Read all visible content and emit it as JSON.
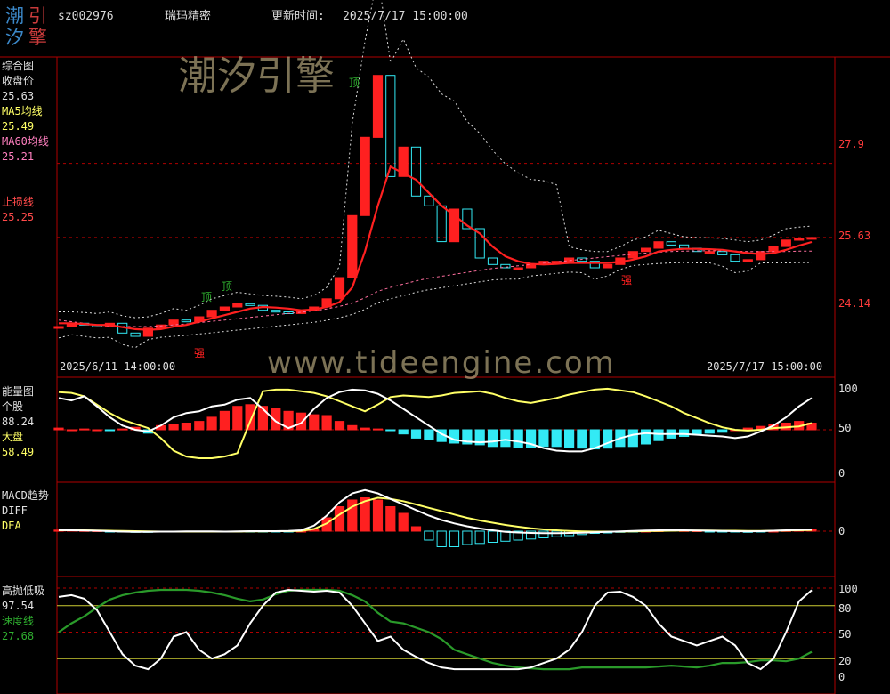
{
  "header": {
    "logo": [
      "潮",
      "引",
      "汐",
      "擎"
    ],
    "code": "sz002976",
    "name": "瑞玛精密",
    "update_label": "更新时间:",
    "update_time": "2025/7/17 15:00:00"
  },
  "watermark": {
    "cn": "潮汐引擎",
    "url": "www.tideengine.com"
  },
  "colors": {
    "up": "#ff2020",
    "down": "#33eaf5",
    "yellow": "#ffff66",
    "white": "#ffffff",
    "green": "#2a9a2a",
    "frame": "#b00000",
    "label_red": "#ff4a4a"
  },
  "panels": {
    "main": {
      "title": "综合图",
      "close_label": "收盘价",
      "close_value": "25.63",
      "ma5_label": "MA5均线",
      "ma5_value": "25.49",
      "ma60_label": "MA60均线",
      "ma60_value": "25.21",
      "stop_label": "止损线",
      "stop_value": "25.25",
      "right_ticks": [
        "27.9",
        "25.63",
        "24.14"
      ],
      "start_date": "2025/6/11 14:00:00",
      "end_date": "2025/7/17 15:00:00",
      "marks": [
        {
          "text": "顶",
          "color": "#2faf2f"
        },
        {
          "text": "顶",
          "color": "#2faf2f"
        },
        {
          "text": "顶",
          "color": "#2faf2f"
        },
        {
          "text": "强",
          "color": "#ff2020"
        },
        {
          "text": "强",
          "color": "#ff2020"
        }
      ]
    },
    "energy": {
      "title": "能量图",
      "stock_label": "个股",
      "stock_value": "88.24",
      "market_label": "大盘",
      "market_value": "58.49",
      "right_ticks": [
        "100",
        "50",
        "0"
      ]
    },
    "macd": {
      "title": "MACD趋势",
      "diff_label": "DIFF",
      "dea_label": "DEA",
      "right_ticks": [
        "0"
      ]
    },
    "hilo": {
      "title": "高抛低吸",
      "value": "97.54",
      "speed_label": "速度线",
      "speed_value": "27.68",
      "right_ticks": [
        "100",
        "80",
        "50",
        "20",
        "0"
      ]
    }
  },
  "chart_data": [
    {
      "type": "line",
      "title": "综合图",
      "x_range": [
        "2025/6/11 14:00:00",
        "2025/7/17 15:00:00"
      ],
      "n": 60,
      "candles_close": [
        22.9,
        23.0,
        22.95,
        22.9,
        23.0,
        22.7,
        22.6,
        22.85,
        22.95,
        23.1,
        23.05,
        23.2,
        23.4,
        23.5,
        23.6,
        23.55,
        23.4,
        23.35,
        23.3,
        23.4,
        23.5,
        23.75,
        24.4,
        26.3,
        28.7,
        30.6,
        27.5,
        28.4,
        26.9,
        26.6,
        25.5,
        26.5,
        25.9,
        25.0,
        24.8,
        24.7,
        24.7,
        24.8,
        24.9,
        24.9,
        25.0,
        24.9,
        24.7,
        24.8,
        25.0,
        25.2,
        25.3,
        25.5,
        25.4,
        25.3,
        25.2,
        25.2,
        25.1,
        24.9,
        24.95,
        25.2,
        25.35,
        25.55,
        25.6,
        25.63
      ],
      "series": [
        {
          "name": "MA5均线",
          "values": [
            23.0,
            23.0,
            22.98,
            22.95,
            22.95,
            22.88,
            22.82,
            22.8,
            22.82,
            22.9,
            22.95,
            23.05,
            23.15,
            23.25,
            23.35,
            23.45,
            23.5,
            23.48,
            23.45,
            23.4,
            23.42,
            23.5,
            23.65,
            24.1,
            25.2,
            26.6,
            27.8,
            27.6,
            27.4,
            27.0,
            26.6,
            26.3,
            26.0,
            25.75,
            25.35,
            25.05,
            24.9,
            24.82,
            24.8,
            24.82,
            24.85,
            24.85,
            24.85,
            24.85,
            24.88,
            24.95,
            25.05,
            25.2,
            25.25,
            25.28,
            25.28,
            25.27,
            25.25,
            25.2,
            25.15,
            25.12,
            25.15,
            25.25,
            25.38,
            25.49
          ]
        },
        {
          "name": "MA60均线",
          "values": [
            23.1,
            23.05,
            23.0,
            22.95,
            22.92,
            22.9,
            22.9,
            22.9,
            22.92,
            22.95,
            22.98,
            23.02,
            23.06,
            23.1,
            23.14,
            23.18,
            23.22,
            23.26,
            23.3,
            23.34,
            23.38,
            23.44,
            23.52,
            23.62,
            23.78,
            23.98,
            24.1,
            24.2,
            24.3,
            24.38,
            24.44,
            24.5,
            24.56,
            24.62,
            24.68,
            24.72,
            24.76,
            24.8,
            24.84,
            24.88,
            24.92,
            24.96,
            25.0,
            25.04,
            25.08,
            25.12,
            25.15,
            25.18,
            25.2,
            25.21,
            25.22,
            25.22,
            25.22,
            25.21,
            25.2,
            25.2,
            25.2,
            25.2,
            25.21,
            25.21
          ]
        }
      ],
      "right_ticks": [
        27.9,
        25.63,
        24.14
      ]
    },
    {
      "type": "bar",
      "title": "能量图",
      "ylim": [
        0,
        100
      ],
      "hist": [
        52,
        50,
        51,
        50,
        49,
        51,
        53,
        46,
        55,
        56,
        58,
        60,
        65,
        72,
        78,
        80,
        78,
        75,
        72,
        70,
        68,
        67,
        60,
        55,
        52,
        51,
        49,
        45,
        40,
        38,
        36,
        34,
        33,
        32,
        30,
        30,
        29,
        29,
        30,
        30,
        29,
        28,
        27,
        28,
        30,
        30,
        33,
        37,
        40,
        42,
        45,
        46,
        47,
        50,
        52,
        54,
        56,
        58,
        60,
        58
      ],
      "series": [
        {
          "name": "个股",
          "values": [
            88,
            85,
            90,
            78,
            65,
            55,
            50,
            48,
            55,
            65,
            70,
            72,
            78,
            80,
            86,
            88,
            75,
            60,
            52,
            58,
            75,
            88,
            95,
            98,
            97,
            93,
            85,
            75,
            65,
            55,
            45,
            38,
            36,
            35,
            36,
            38,
            36,
            33,
            28,
            25,
            24,
            24,
            28,
            34,
            40,
            44,
            46,
            45,
            45,
            45,
            44,
            43,
            42,
            40,
            42,
            48,
            55,
            65,
            78,
            88
          ]
        },
        {
          "name": "大盘",
          "values": [
            95,
            94,
            90,
            80,
            70,
            62,
            57,
            52,
            40,
            25,
            18,
            16,
            16,
            18,
            22,
            60,
            96,
            98,
            98,
            96,
            94,
            90,
            84,
            78,
            72,
            80,
            89,
            91,
            90,
            89,
            91,
            94,
            95,
            96,
            93,
            88,
            84,
            82,
            85,
            88,
            92,
            95,
            98,
            99,
            97,
            95,
            90,
            84,
            78,
            70,
            64,
            58,
            53,
            50,
            49,
            50,
            52,
            53,
            54,
            58
          ]
        }
      ]
    },
    {
      "type": "bar",
      "title": "MACD趋势",
      "hist": [
        0.05,
        0.04,
        0.03,
        0.02,
        -0.02,
        -0.04,
        -0.05,
        -0.05,
        -0.04,
        -0.03,
        -0.02,
        -0.02,
        -0.03,
        -0.04,
        -0.03,
        -0.03,
        -0.02,
        -0.01,
        -0.01,
        0.0,
        0.1,
        0.6,
        1.1,
        1.4,
        1.5,
        1.4,
        1.1,
        0.8,
        0.2,
        -0.4,
        -0.7,
        -0.7,
        -0.6,
        -0.55,
        -0.5,
        -0.45,
        -0.4,
        -0.35,
        -0.3,
        -0.25,
        -0.2,
        -0.15,
        -0.1,
        -0.08,
        -0.05,
        -0.02,
        0.0,
        0.02,
        0.04,
        0.03,
        0.02,
        -0.01,
        -0.02,
        -0.04,
        -0.05,
        -0.03,
        0.0,
        0.03,
        0.05,
        0.06
      ],
      "series": [
        {
          "name": "DIFF",
          "values": [
            0.05,
            0.04,
            0.03,
            0.02,
            0.0,
            -0.02,
            -0.03,
            -0.03,
            -0.02,
            -0.02,
            -0.01,
            -0.01,
            -0.01,
            -0.02,
            -0.01,
            0.0,
            0.0,
            0.0,
            0.01,
            0.04,
            0.25,
            0.7,
            1.3,
            1.7,
            1.85,
            1.7,
            1.45,
            1.2,
            0.95,
            0.7,
            0.5,
            0.35,
            0.22,
            0.12,
            0.04,
            -0.03,
            -0.06,
            -0.08,
            -0.09,
            -0.09,
            -0.08,
            -0.07,
            -0.05,
            -0.03,
            -0.01,
            0.01,
            0.03,
            0.04,
            0.05,
            0.04,
            0.03,
            0.02,
            0.01,
            0.0,
            -0.01,
            0.0,
            0.02,
            0.04,
            0.06,
            0.08
          ]
        },
        {
          "name": "DEA",
          "values": [
            0.04,
            0.04,
            0.04,
            0.03,
            0.02,
            0.01,
            0.0,
            -0.01,
            -0.02,
            -0.02,
            -0.02,
            -0.02,
            -0.02,
            -0.02,
            -0.02,
            -0.01,
            -0.01,
            0.0,
            0.0,
            0.01,
            0.1,
            0.35,
            0.75,
            1.1,
            1.35,
            1.5,
            1.45,
            1.35,
            1.2,
            1.05,
            0.9,
            0.75,
            0.6,
            0.48,
            0.38,
            0.28,
            0.2,
            0.13,
            0.08,
            0.04,
            0.01,
            -0.01,
            -0.02,
            -0.02,
            -0.02,
            -0.01,
            0.0,
            0.01,
            0.02,
            0.03,
            0.03,
            0.03,
            0.02,
            0.02,
            0.01,
            0.01,
            0.02,
            0.03,
            0.04,
            0.05
          ]
        }
      ]
    },
    {
      "type": "line",
      "title": "高抛低吸",
      "ylim": [
        0,
        100
      ],
      "series": [
        {
          "name": "高抛低吸",
          "values": [
            90,
            92,
            88,
            75,
            50,
            25,
            12,
            8,
            20,
            45,
            50,
            30,
            20,
            25,
            35,
            60,
            80,
            95,
            98,
            97,
            96,
            97,
            95,
            80,
            60,
            40,
            45,
            30,
            22,
            15,
            10,
            8,
            8,
            8,
            8,
            8,
            8,
            10,
            15,
            20,
            30,
            50,
            80,
            95,
            96,
            90,
            80,
            60,
            45,
            40,
            35,
            40,
            45,
            35,
            15,
            8,
            20,
            50,
            85,
            97.54
          ]
        },
        {
          "name": "速度线",
          "values": [
            50,
            60,
            68,
            78,
            87,
            92,
            95,
            97,
            98,
            98,
            98,
            97,
            95,
            92,
            88,
            85,
            87,
            93,
            97,
            98,
            98,
            98,
            97,
            92,
            85,
            72,
            62,
            60,
            55,
            50,
            42,
            30,
            25,
            20,
            15,
            12,
            10,
            9,
            8,
            8,
            8,
            10,
            10,
            10,
            10,
            10,
            10,
            11,
            12,
            11,
            10,
            12,
            15,
            15,
            16,
            18,
            18,
            17,
            20,
            27.68
          ]
        }
      ]
    }
  ]
}
